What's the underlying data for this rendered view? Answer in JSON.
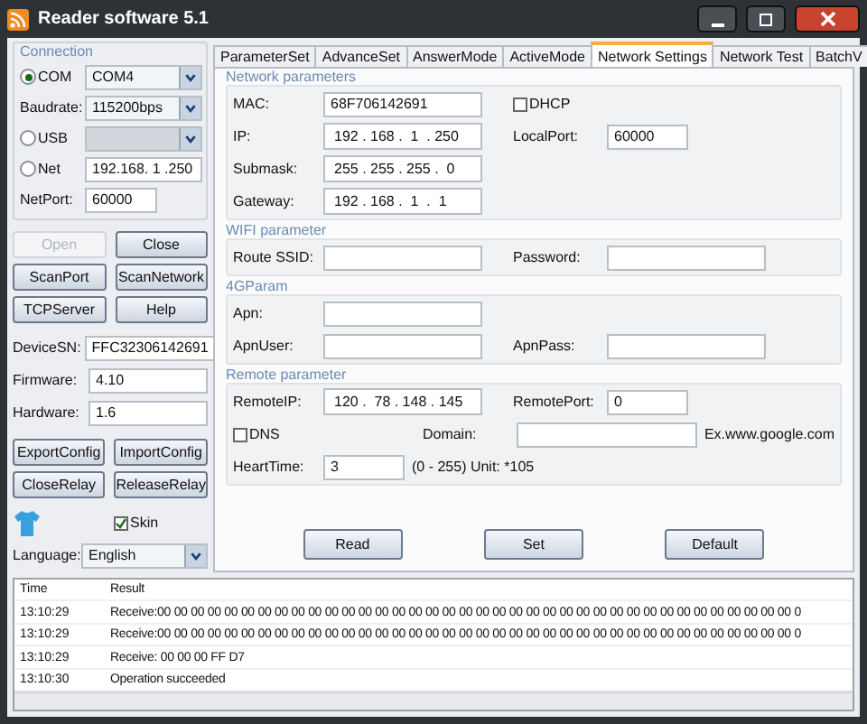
{
  "window": {
    "title": "Reader software 5.1"
  },
  "connection": {
    "title": "Connection",
    "rows": [
      {
        "kind": "radiodropdown",
        "label": "COM",
        "selected": true,
        "value": "COM4"
      },
      {
        "kind": "dropdown",
        "label": "Baudrate:",
        "value": "115200bps"
      },
      {
        "kind": "radiodropdown",
        "label": "USB",
        "selected": false,
        "disabled": true
      },
      {
        "kind": "radiotext",
        "label": "Net",
        "selected": false,
        "value": "192.168. 1 .250"
      },
      {
        "kind": "shorttext",
        "label": "NetPort:",
        "value": "60000"
      }
    ]
  },
  "connection_buttons": [
    {
      "label": "Open",
      "disabled": true
    },
    {
      "label": "Close",
      "disabled": false
    },
    {
      "label": "ScanPort",
      "disabled": false
    },
    {
      "label": "ScanNetwork",
      "disabled": false
    },
    {
      "label": "TCPServer",
      "disabled": false
    },
    {
      "label": "Help",
      "disabled": false
    }
  ],
  "device": [
    {
      "label": "DeviceSN:",
      "value": "FFC32306142691"
    },
    {
      "label": "Firmware:",
      "value": "4.10"
    },
    {
      "label": "Hardware:",
      "value": "1.6"
    }
  ],
  "config_buttons": [
    {
      "label": "ExportConfig"
    },
    {
      "label": "ImportConfig"
    },
    {
      "label": "CloseRelay"
    },
    {
      "label": "ReleaseRelay"
    }
  ],
  "skin": {
    "label": "Skin",
    "checked": true
  },
  "language": {
    "label": "Language:",
    "value": "English"
  },
  "tabs": [
    {
      "label": "ParameterSet",
      "selected": false
    },
    {
      "label": "AdvanceSet",
      "selected": false
    },
    {
      "label": "AnswerMode",
      "selected": false
    },
    {
      "label": "ActiveMode",
      "selected": false
    },
    {
      "label": "Network Settings",
      "selected": true
    },
    {
      "label": "Network Test",
      "selected": false
    },
    {
      "label": "BatchV",
      "selected": false
    }
  ],
  "groups": [
    {
      "title": "Network parameters",
      "rows": [
        [
          {
            "kind": "text",
            "label": "MAC:",
            "value": "68F706142691"
          },
          {
            "kind": "checkbox",
            "label": "DHCP",
            "checked": false
          }
        ],
        [
          {
            "kind": "ip",
            "label": "IP:",
            "value": "192 . 168 .  1  . 250"
          },
          {
            "kind": "text",
            "label": "LocalPort:",
            "value": "60000",
            "short": true
          }
        ],
        [
          {
            "kind": "ip",
            "label": "Submask:",
            "value": "255 . 255 . 255 .  0"
          }
        ],
        [
          {
            "kind": "ip",
            "label": "Gateway:",
            "value": "192 . 168 .  1  .  1"
          }
        ]
      ]
    },
    {
      "title": "WIFI parameter",
      "rows": [
        [
          {
            "kind": "text",
            "label": "Route SSID:"
          },
          {
            "kind": "text",
            "label": "Password:"
          }
        ]
      ]
    },
    {
      "title": "4GParam",
      "rows": [
        [
          {
            "kind": "text",
            "label": "Apn:"
          }
        ],
        [
          {
            "kind": "text",
            "label": "ApnUser:"
          },
          {
            "kind": "text",
            "label": "ApnPass:"
          }
        ]
      ]
    },
    {
      "title": "Remote parameter",
      "rows": [
        [
          {
            "kind": "ip",
            "label": "RemoteIP:",
            "value": "120 .  78 . 148 . 145"
          },
          {
            "kind": "text",
            "label": "RemotePort:",
            "value": "0",
            "short": true
          }
        ],
        [
          {
            "kind": "checkbox",
            "label": "DNS",
            "checked": false
          },
          {
            "kind": "text",
            "label": "Domain:"
          },
          {
            "kind": "note",
            "text": "Ex.www.google.com"
          }
        ],
        [
          {
            "kind": "text",
            "label": "HeartTime:",
            "value": "3",
            "short": true
          },
          {
            "kind": "note",
            "text": "(0 - 255) Unit: *105"
          }
        ]
      ]
    }
  ],
  "actions": [
    {
      "label": "Read"
    },
    {
      "label": "Set"
    },
    {
      "label": "Default"
    }
  ],
  "log": {
    "columns": [
      "Time",
      "Result"
    ],
    "rows": [
      [
        "13:10:29",
        "Receive:00 00 00 00 00 00 00 00 00 00 00 00 00 00 00 00 00 00 00 00 00 00 00 00 00 00 00 00 00 00 00 00 00 00 00 00 00 00 0"
      ],
      [
        "13:10:29",
        "Receive:00 00 00 00 00 00 00 00 00 00 00 00 00 00 00 00 00 00 00 00 00 00 00 00 00 00 00 00 00 00 00 00 00 00 00 00 00 00 0"
      ],
      [
        "13:10:29",
        "Receive: 00 00 00 FF D7"
      ],
      [
        "13:10:30",
        "Operation succeeded"
      ]
    ]
  }
}
